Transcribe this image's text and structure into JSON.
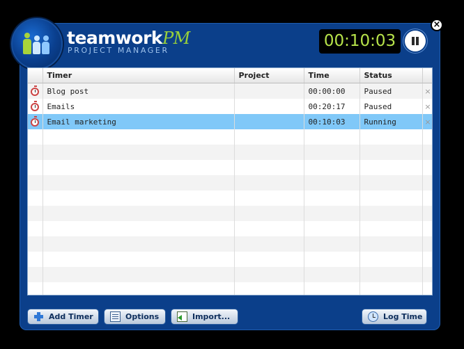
{
  "header": {
    "brand_main": "teamwork",
    "brand_accent": "PM",
    "brand_sub": "PROJECT MANAGER",
    "timer_display": "00:10:03"
  },
  "table": {
    "columns": [
      "Timer",
      "Project",
      "Time",
      "Status"
    ],
    "rows": [
      {
        "name": "Blog post",
        "project": "",
        "time": "00:00:00",
        "status": "Paused"
      },
      {
        "name": "Emails",
        "project": "",
        "time": "00:20:17",
        "status": "Paused"
      },
      {
        "name": "Email marketing",
        "project": "",
        "time": "00:10:03",
        "status": "Running"
      }
    ],
    "delete_glyph": "×",
    "selected_row": 2
  },
  "footer": {
    "add_timer": "Add Timer",
    "options": "Options",
    "import": "Import...",
    "log_time": "Log Time"
  },
  "colors": {
    "window_bg": "#0b3f8a",
    "timer_text": "#b7e34a",
    "selected_row": "#80c8f8",
    "accent_green": "#9ad13a"
  },
  "icons": {
    "close": "close-icon",
    "pause": "pause-icon",
    "row": "stopwatch-icon",
    "add": "plus-icon",
    "options": "options-icon",
    "import": "import-icon",
    "log": "log-time-icon"
  }
}
